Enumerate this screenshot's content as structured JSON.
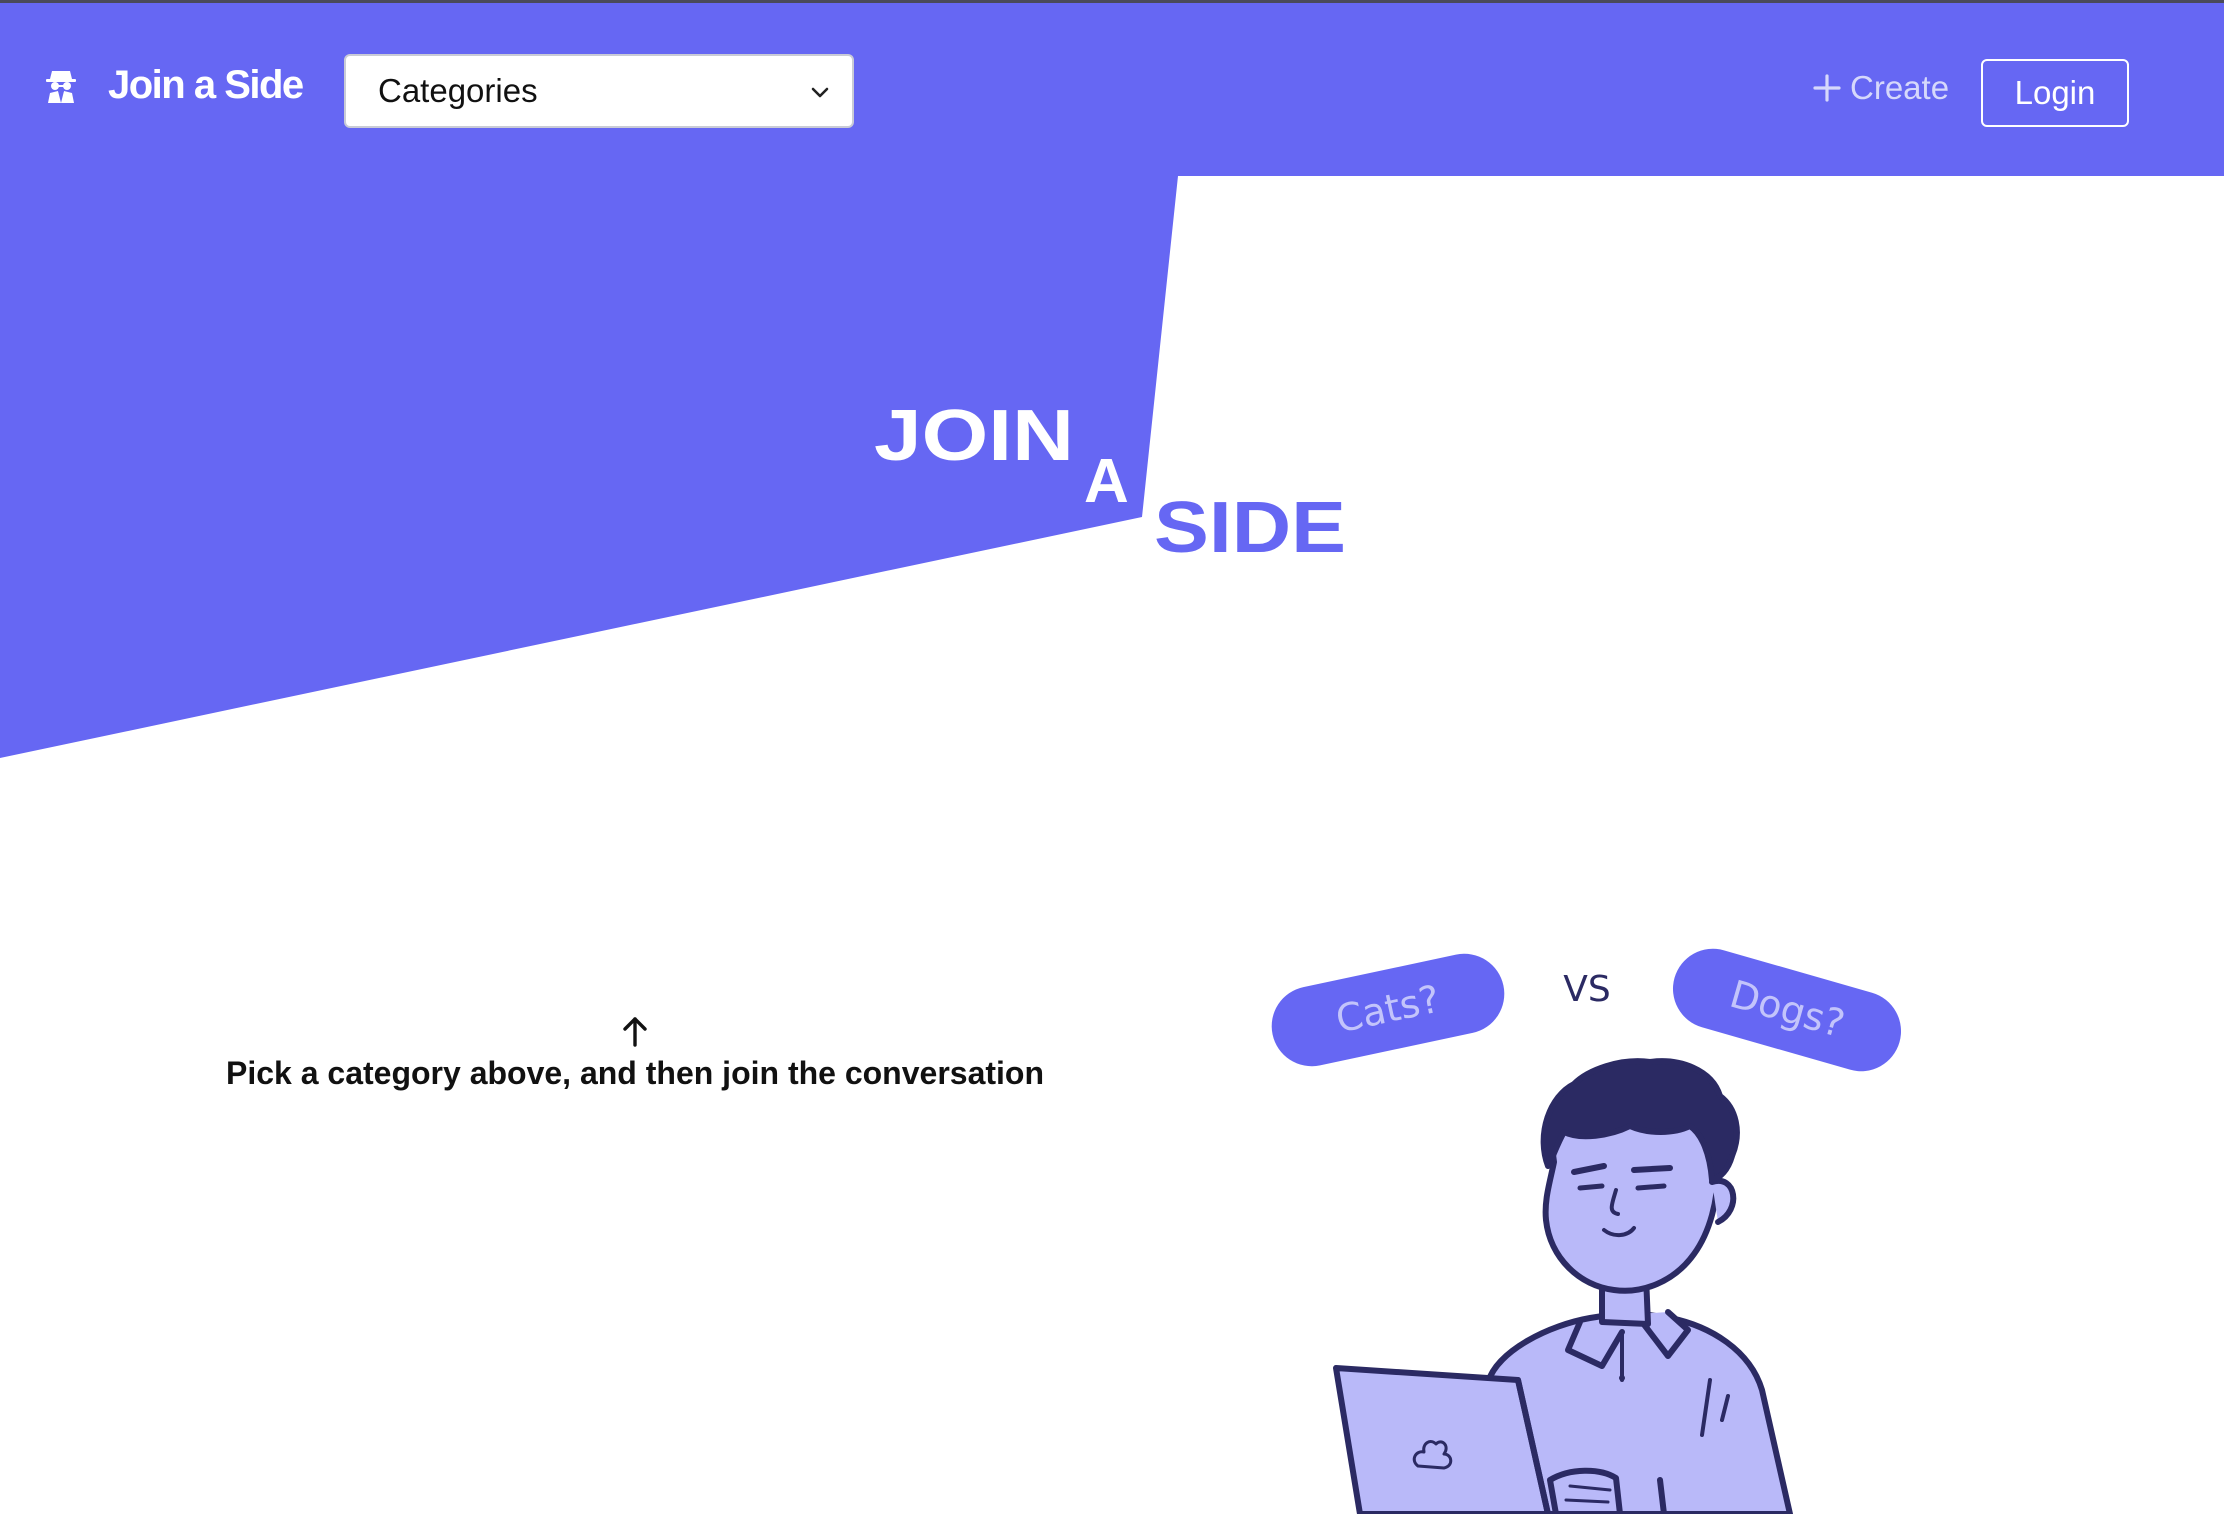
{
  "navbar": {
    "brand_name": "Join a Side",
    "brand_icon": "spy-icon",
    "category_select": {
      "label": "Categories",
      "icon": "chevron-down-icon"
    },
    "create_label": "Create",
    "create_icon": "plus-icon",
    "login_label": "Login"
  },
  "hero": {
    "title_join": "JOIN",
    "title_a": "A",
    "title_side": "SIDE"
  },
  "instruction": {
    "icon": "arrow-up-icon",
    "text": "Pick a category above, and then join the conversation"
  },
  "illustration": {
    "left_bubble": "Cats?",
    "versus": "VS",
    "right_bubble": "Dogs?"
  },
  "colors": {
    "brand": "#6667f3",
    "brand_light": "#b9b9f9",
    "dark_navy": "#2b2a63",
    "white": "#ffffff"
  }
}
